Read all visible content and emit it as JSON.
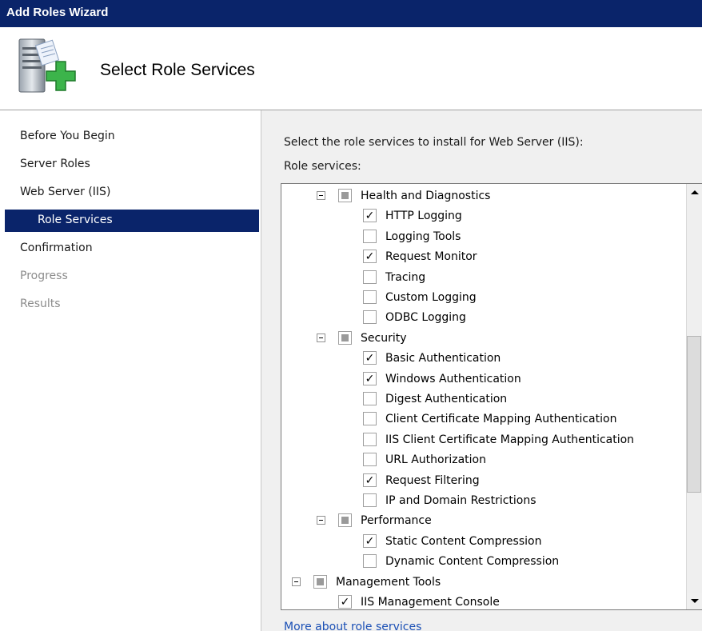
{
  "window": {
    "title": "Add Roles Wizard"
  },
  "header": {
    "title": "Select Role Services",
    "icon": "server-add-icon"
  },
  "nav": {
    "items": [
      {
        "label": "Before You Begin",
        "state": "normal"
      },
      {
        "label": "Server Roles",
        "state": "normal"
      },
      {
        "label": "Web Server (IIS)",
        "state": "normal"
      },
      {
        "label": "Role Services",
        "state": "selected"
      },
      {
        "label": "Confirmation",
        "state": "normal"
      },
      {
        "label": "Progress",
        "state": "disabled"
      },
      {
        "label": "Results",
        "state": "disabled"
      }
    ]
  },
  "content": {
    "instruction": "Select the role services to install for Web Server (IIS):",
    "role_services_label": "Role services:",
    "more_link": "More about role services"
  },
  "tree": [
    {
      "label": "Health and Diagnostics",
      "level": 1,
      "type": "group",
      "state": "partial"
    },
    {
      "label": "HTTP Logging",
      "level": 2,
      "type": "item",
      "state": "checked"
    },
    {
      "label": "Logging Tools",
      "level": 2,
      "type": "item",
      "state": "unchecked"
    },
    {
      "label": "Request Monitor",
      "level": 2,
      "type": "item",
      "state": "checked"
    },
    {
      "label": "Tracing",
      "level": 2,
      "type": "item",
      "state": "unchecked"
    },
    {
      "label": "Custom Logging",
      "level": 2,
      "type": "item",
      "state": "unchecked"
    },
    {
      "label": "ODBC Logging",
      "level": 2,
      "type": "item",
      "state": "unchecked"
    },
    {
      "label": "Security",
      "level": 1,
      "type": "group",
      "state": "partial"
    },
    {
      "label": "Basic Authentication",
      "level": 2,
      "type": "item",
      "state": "checked"
    },
    {
      "label": "Windows Authentication",
      "level": 2,
      "type": "item",
      "state": "checked"
    },
    {
      "label": "Digest Authentication",
      "level": 2,
      "type": "item",
      "state": "unchecked"
    },
    {
      "label": "Client Certificate Mapping Authentication",
      "level": 2,
      "type": "item",
      "state": "unchecked"
    },
    {
      "label": "IIS Client Certificate Mapping Authentication",
      "level": 2,
      "type": "item",
      "state": "unchecked"
    },
    {
      "label": "URL Authorization",
      "level": 2,
      "type": "item",
      "state": "unchecked"
    },
    {
      "label": "Request Filtering",
      "level": 2,
      "type": "item",
      "state": "checked"
    },
    {
      "label": "IP and Domain Restrictions",
      "level": 2,
      "type": "item",
      "state": "unchecked"
    },
    {
      "label": "Performance",
      "level": 1,
      "type": "group",
      "state": "partial"
    },
    {
      "label": "Static Content Compression",
      "level": 2,
      "type": "item",
      "state": "checked"
    },
    {
      "label": "Dynamic Content Compression",
      "level": 2,
      "type": "item",
      "state": "unchecked"
    },
    {
      "label": "Management Tools",
      "level": 0,
      "type": "group",
      "state": "partial"
    },
    {
      "label": "IIS Management Console",
      "level": 1,
      "type": "item",
      "state": "checked"
    }
  ],
  "colors": {
    "titlebar": "#0a246a",
    "selection": "#0a246a",
    "link": "#1a4fb5"
  }
}
